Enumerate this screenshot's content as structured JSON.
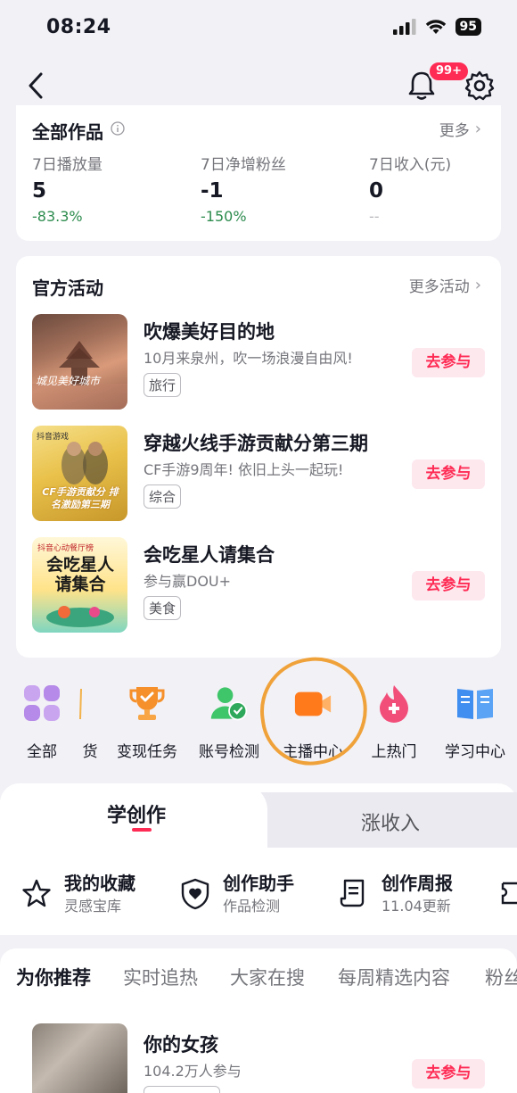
{
  "status_bar": {
    "time": "08:24",
    "battery": "95"
  },
  "nav": {
    "notification_badge": "99+"
  },
  "works": {
    "title": "全部作品",
    "more": "更多",
    "stats": [
      {
        "label": "7日播放量",
        "value": "5",
        "change": "-83.3%"
      },
      {
        "label": "7日净增粉丝",
        "value": "-1",
        "change": "-150%"
      },
      {
        "label": "7日收入(元)",
        "value": "0",
        "change": "--"
      }
    ]
  },
  "activities": {
    "title": "官方活动",
    "more": "更多活动",
    "join_label": "去参与",
    "items": [
      {
        "title": "吹爆美好目的地",
        "subtitle": "10月来泉州，吹一场浪漫自由风!",
        "tag": "旅行",
        "thumb_text": "城见美好城市"
      },
      {
        "title": "穿越火线手游贡献分第三期",
        "subtitle": "CF手游9周年! 依旧上头一起玩!",
        "tag": "综合",
        "thumb_text": "CF手游贡献分 排名激励第三期",
        "thumb_brand": "抖音游戏"
      },
      {
        "title": "会吃星人请集合",
        "subtitle": "参与赢DOU+",
        "tag": "美食",
        "thumb_text": "会吃星人 请集合",
        "thumb_brand": "抖音心动餐厅榜"
      }
    ]
  },
  "tools": [
    {
      "label": "全部",
      "icon": "grid-icon"
    },
    {
      "label": "货",
      "icon": "goods-icon"
    },
    {
      "label": "变现任务",
      "icon": "trophy-icon"
    },
    {
      "label": "账号检测",
      "icon": "account-check-icon"
    },
    {
      "label": "主播中心",
      "icon": "video-camera-icon"
    },
    {
      "label": "上热门",
      "icon": "flame-icon"
    },
    {
      "label": "学习中心",
      "icon": "book-icon"
    }
  ],
  "learn_tabs": {
    "active": "学创作",
    "other": "涨收入"
  },
  "shortcuts": [
    {
      "title": "我的收藏",
      "subtitle": "灵感宝库",
      "icon": "star-icon"
    },
    {
      "title": "创作助手",
      "subtitle": "作品检测",
      "icon": "shield-heart-icon"
    },
    {
      "title": "创作周报",
      "subtitle": "11.04更新",
      "icon": "scroll-icon"
    }
  ],
  "recommend": {
    "tabs": [
      "为你推荐",
      "实时追热",
      "大家在搜",
      "每周精选内容",
      "粉丝"
    ],
    "items": [
      {
        "title": "你的女孩",
        "subtitle": "104.2万人参与",
        "join_label": "去参与"
      }
    ]
  },
  "colors": {
    "accent": "#fe2c55",
    "positive": "#2d8c4e",
    "annotation": "#f0a23a"
  }
}
